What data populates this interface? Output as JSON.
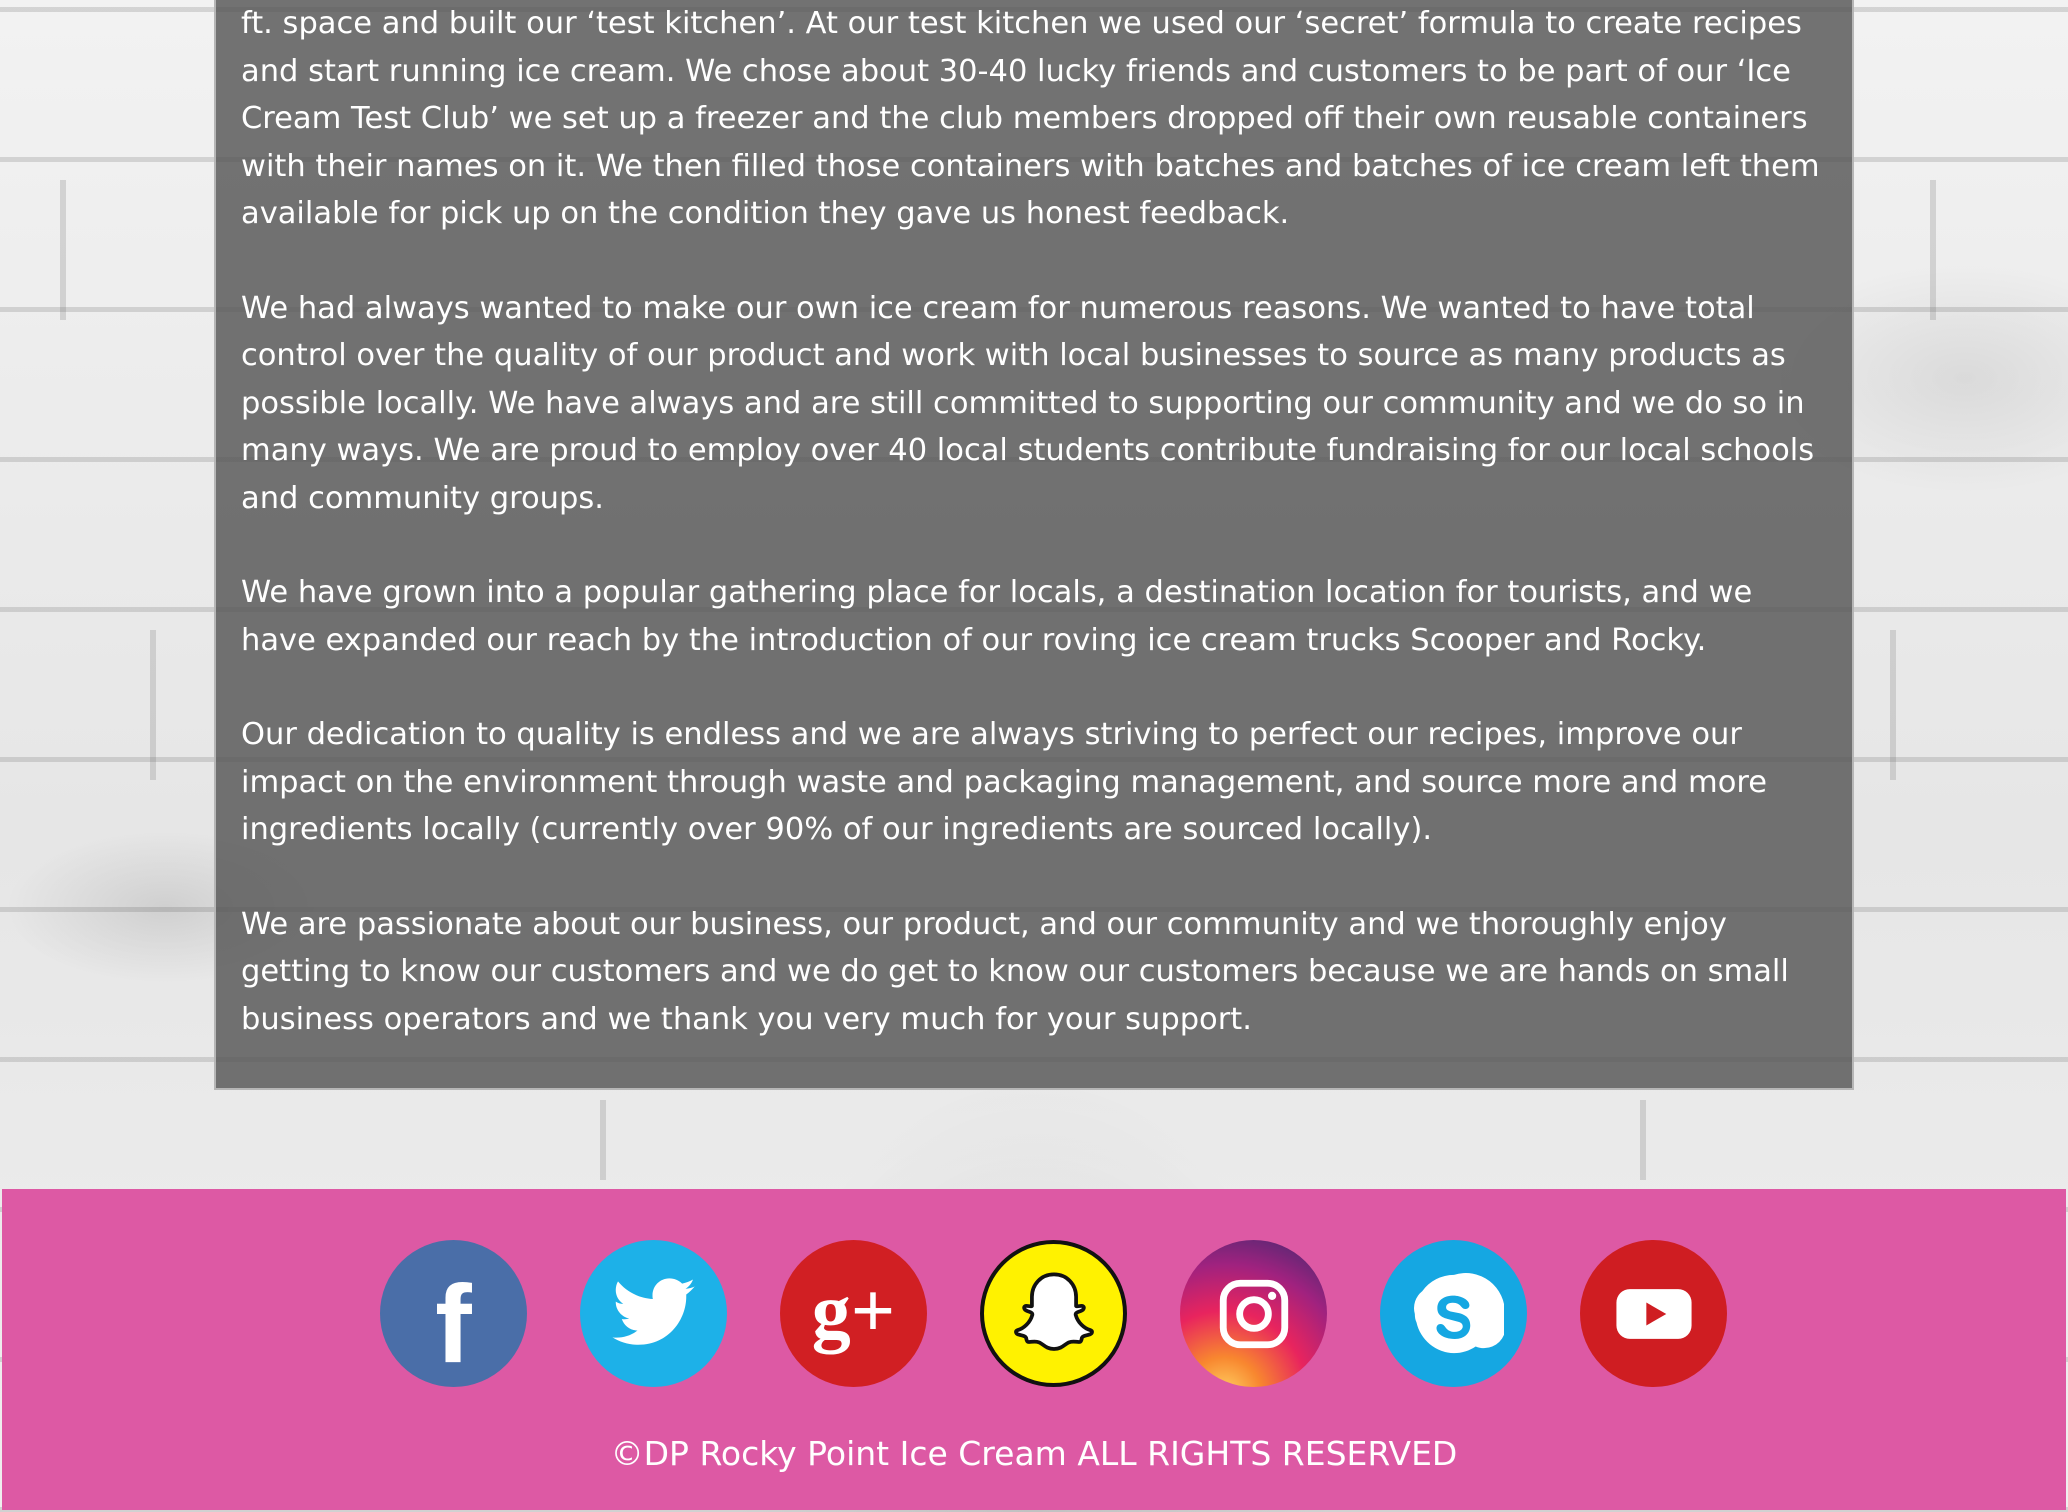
{
  "about": {
    "paragraphs": [
      "ft. space and built our ‘test kitchen’. At our test kitchen we used our ‘secret’ formula to create recipes and start running ice cream. We chose about 30-40 lucky friends and customers to be part of our ‘Ice Cream Test Club’ we set up a freezer and the club members dropped off their own reusable containers with their names on it. We then filled those containers with batches and batches of ice cream left them available for pick up on the condition they gave us honest feedback.",
      "We had always wanted to make our own ice cream for numerous reasons. We wanted to have total control over the quality of our product and work with local businesses to source as many products as possible locally. We have always and are still committed to supporting our community and we do so in many ways. We are proud to employ over 40 local students contribute fundraising for our local schools and community groups.",
      "We have grown into a popular gathering place for locals, a destination location for tourists, and we have expanded our reach by the introduction of our roving ice cream trucks Scooper and Rocky.",
      "Our dedication to quality is endless and we are always striving to perfect our recipes, improve our impact on the environment through waste and packaging management, and source more and more ingredients locally (currently over 90% of our ingredients are sourced locally).",
      "We are passionate about our business, our product, and our community and we thoroughly enjoy getting to know our customers and we do get to know our customers because we are hands on small business operators and we thank you very much for your support."
    ]
  },
  "footer": {
    "background_color": "#dd59a4",
    "social_icons": [
      {
        "icon": "facebook-icon",
        "color": "#4a6ea8"
      },
      {
        "icon": "twitter-icon",
        "color": "#1db1e8"
      },
      {
        "icon": "google-plus-icon",
        "color": "#d11f23"
      },
      {
        "icon": "snapchat-icon",
        "color": "#fff200"
      },
      {
        "icon": "instagram-icon",
        "color": "#e8245e"
      },
      {
        "icon": "skype-icon",
        "color": "#15a7e2"
      },
      {
        "icon": "youtube-icon",
        "color": "#cf1d22"
      }
    ],
    "facebook_glyph": "f",
    "google_plus_glyph": "g+",
    "copyright": "©DP Rocky Point Ice Cream ALL RIGHTS RESERVED"
  }
}
